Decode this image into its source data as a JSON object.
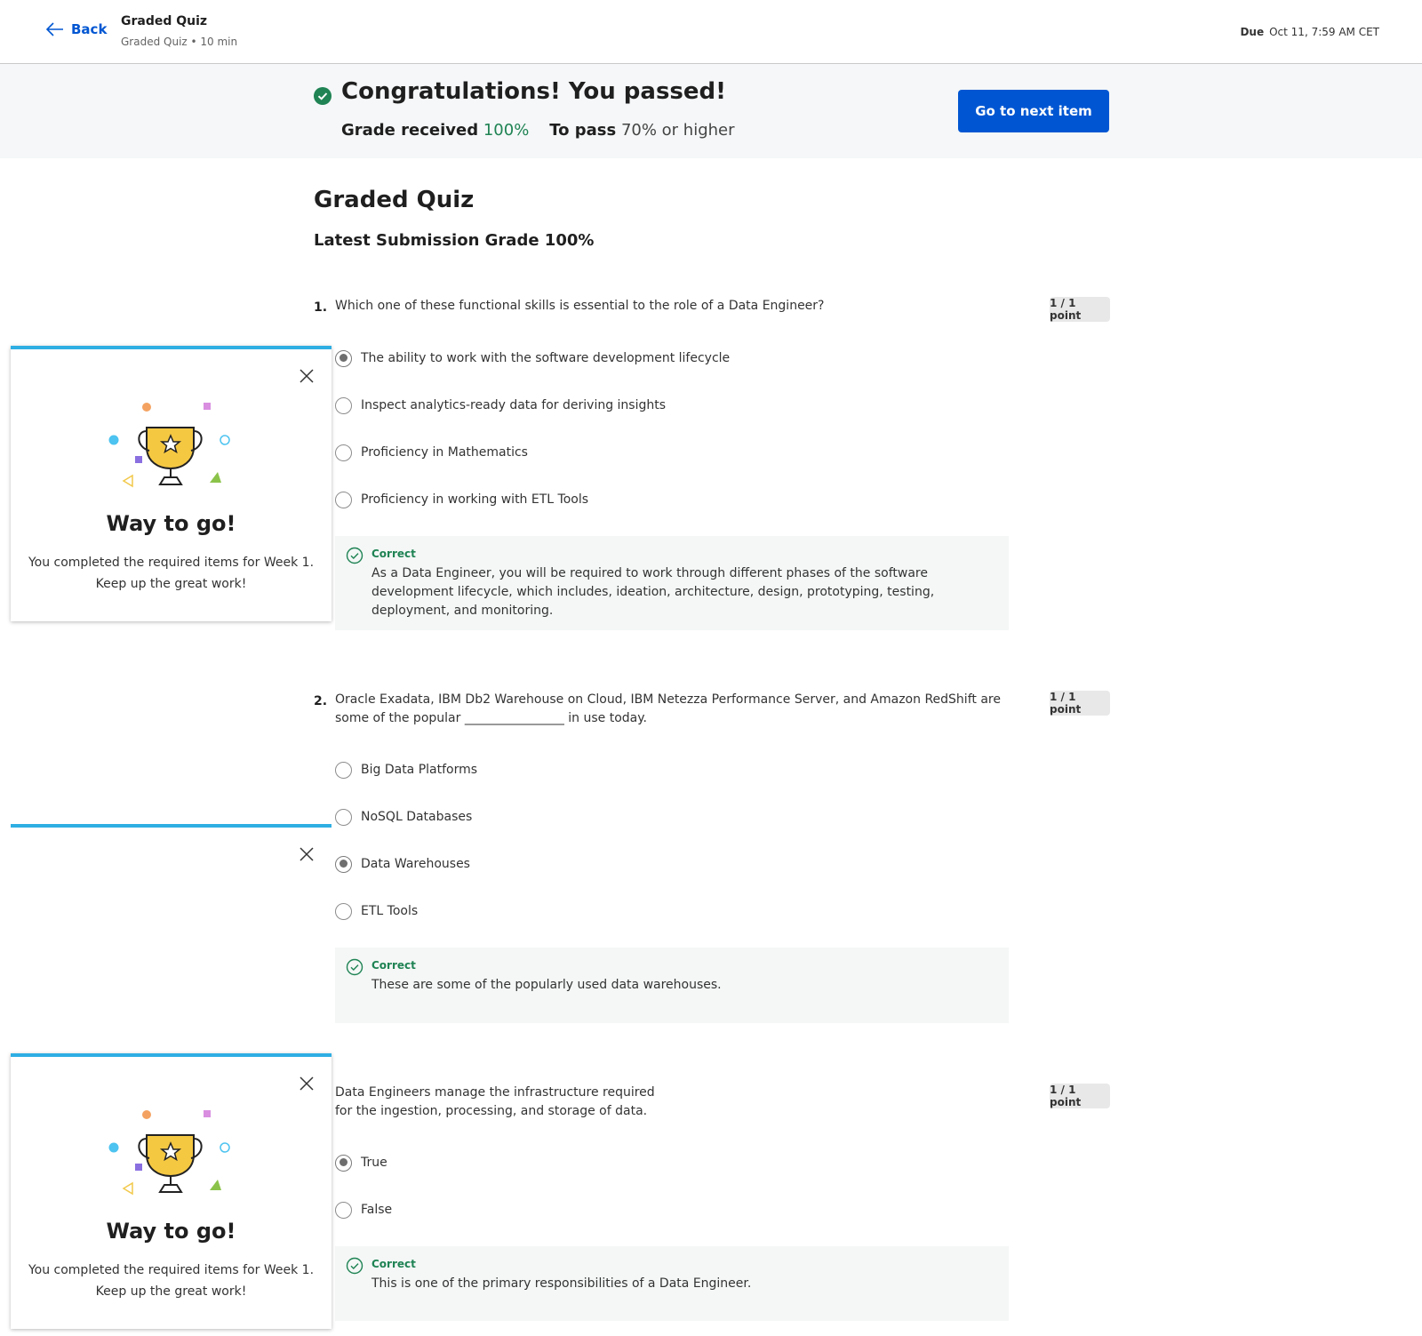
{
  "header": {
    "back_label": "Back",
    "title": "Graded Quiz",
    "subtitle": "Graded Quiz • 10 min",
    "due_label": "Due",
    "due_value": "Oct 11, 7:59 AM CET"
  },
  "banner": {
    "title": "Congratulations! You passed!",
    "grade_label": "Grade received",
    "grade_value": "100%",
    "pass_label": "To pass",
    "pass_value": "70% or higher",
    "next_button": "Go to next item"
  },
  "quiz": {
    "title": "Graded Quiz",
    "latest_grade": "Latest Submission Grade 100%",
    "questions": [
      {
        "number": "1.",
        "text": "Which one of these functional skills is essential to the role of a Data Engineer?",
        "points": "1 / 1 point",
        "options": [
          {
            "label": "The ability to work with the software development lifecycle",
            "selected": true
          },
          {
            "label": "Inspect analytics-ready data for deriving insights",
            "selected": false
          },
          {
            "label": "Proficiency in Mathematics",
            "selected": false
          },
          {
            "label": "Proficiency in working with ETL Tools",
            "selected": false
          }
        ],
        "feedback_label": "Correct",
        "feedback_text": "As a Data Engineer, you will be required to work through different phases of the software development lifecycle, which includes, ideation, architecture, design, prototyping, testing, deployment, and monitoring."
      },
      {
        "number": "2.",
        "text": "Oracle Exadata, IBM Db2 Warehouse on Cloud, IBM Netezza Performance Server, and Amazon RedShift are some of the popular ________________ in use today.",
        "points": "1 / 1 point",
        "options": [
          {
            "label": "Big Data Platforms",
            "selected": false
          },
          {
            "label": "NoSQL Databases",
            "selected": false
          },
          {
            "label": "Data Warehouses",
            "selected": true
          },
          {
            "label": "ETL Tools",
            "selected": false
          }
        ],
        "feedback_label": "Correct",
        "feedback_text": "These are some of the popularly used data warehouses."
      },
      {
        "number": "",
        "text": "Data Engineers manage the infrastructure required for the ingestion, processing, and storage of data.",
        "points": "1 / 1 point",
        "options": [
          {
            "label": "True",
            "selected": true
          },
          {
            "label": "False",
            "selected": false
          }
        ],
        "feedback_label": "Correct",
        "feedback_text": "This is one of the primary responsibilities of a Data Engineer."
      }
    ]
  },
  "toast": {
    "title": "Way to go!",
    "body_line1": "You completed the required items for Week 1.",
    "body_line2": "Keep up the great work!"
  },
  "colors": {
    "accent": "#0056d2",
    "success": "#1f8354",
    "toast_border": "#2eaee3",
    "trophy": "#f5c842"
  }
}
